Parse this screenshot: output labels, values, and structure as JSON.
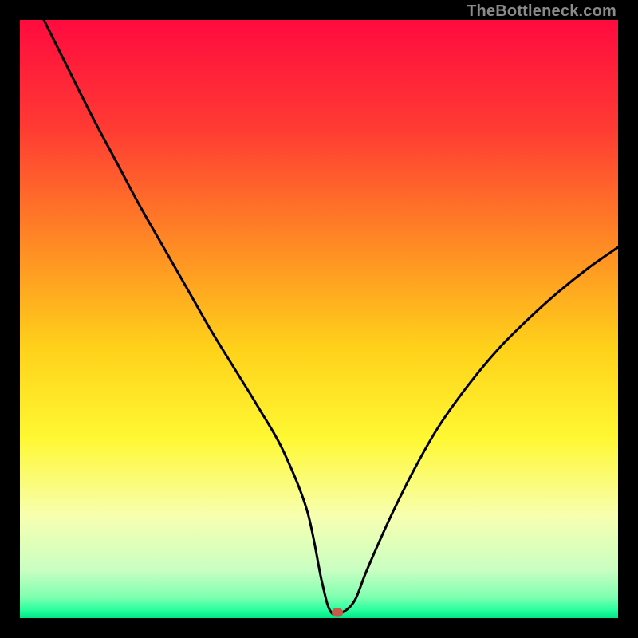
{
  "watermark": "TheBottleneck.com",
  "chart_data": {
    "type": "line",
    "title": "",
    "xlabel": "",
    "ylabel": "",
    "xlim": [
      0,
      100
    ],
    "ylim": [
      0,
      100
    ],
    "grid": false,
    "background_gradient": {
      "stops": [
        {
          "pos": 0.0,
          "color": "#ff0b3f"
        },
        {
          "pos": 0.18,
          "color": "#ff3a33"
        },
        {
          "pos": 0.38,
          "color": "#ff8c24"
        },
        {
          "pos": 0.55,
          "color": "#ffd21a"
        },
        {
          "pos": 0.7,
          "color": "#fff833"
        },
        {
          "pos": 0.83,
          "color": "#f7ffb0"
        },
        {
          "pos": 0.92,
          "color": "#c9ffc2"
        },
        {
          "pos": 0.965,
          "color": "#7fffb0"
        },
        {
          "pos": 0.985,
          "color": "#2dffa0"
        },
        {
          "pos": 1.0,
          "color": "#00e887"
        }
      ]
    },
    "series": [
      {
        "name": "bottleneck-curve",
        "color": "#000000",
        "stroke_width": 3,
        "x": [
          4.0,
          8.0,
          12.0,
          16.0,
          20.0,
          24.0,
          28.0,
          32.0,
          36.0,
          40.0,
          44.0,
          48.0,
          50.5,
          52.0,
          54.0,
          56.0,
          58.0,
          62.0,
          66.0,
          70.0,
          75.0,
          80.0,
          85.0,
          90.0,
          95.0,
          100.0
        ],
        "y": [
          100.0,
          92.0,
          84.0,
          76.5,
          69.0,
          62.0,
          55.0,
          48.0,
          41.5,
          35.0,
          28.0,
          18.0,
          6.0,
          1.0,
          1.0,
          3.0,
          8.0,
          17.0,
          25.0,
          32.0,
          39.0,
          45.0,
          50.0,
          54.5,
          58.5,
          62.0
        ]
      }
    ],
    "marker": {
      "x": 53.0,
      "y": 1.0,
      "color": "#c55a4a"
    }
  }
}
